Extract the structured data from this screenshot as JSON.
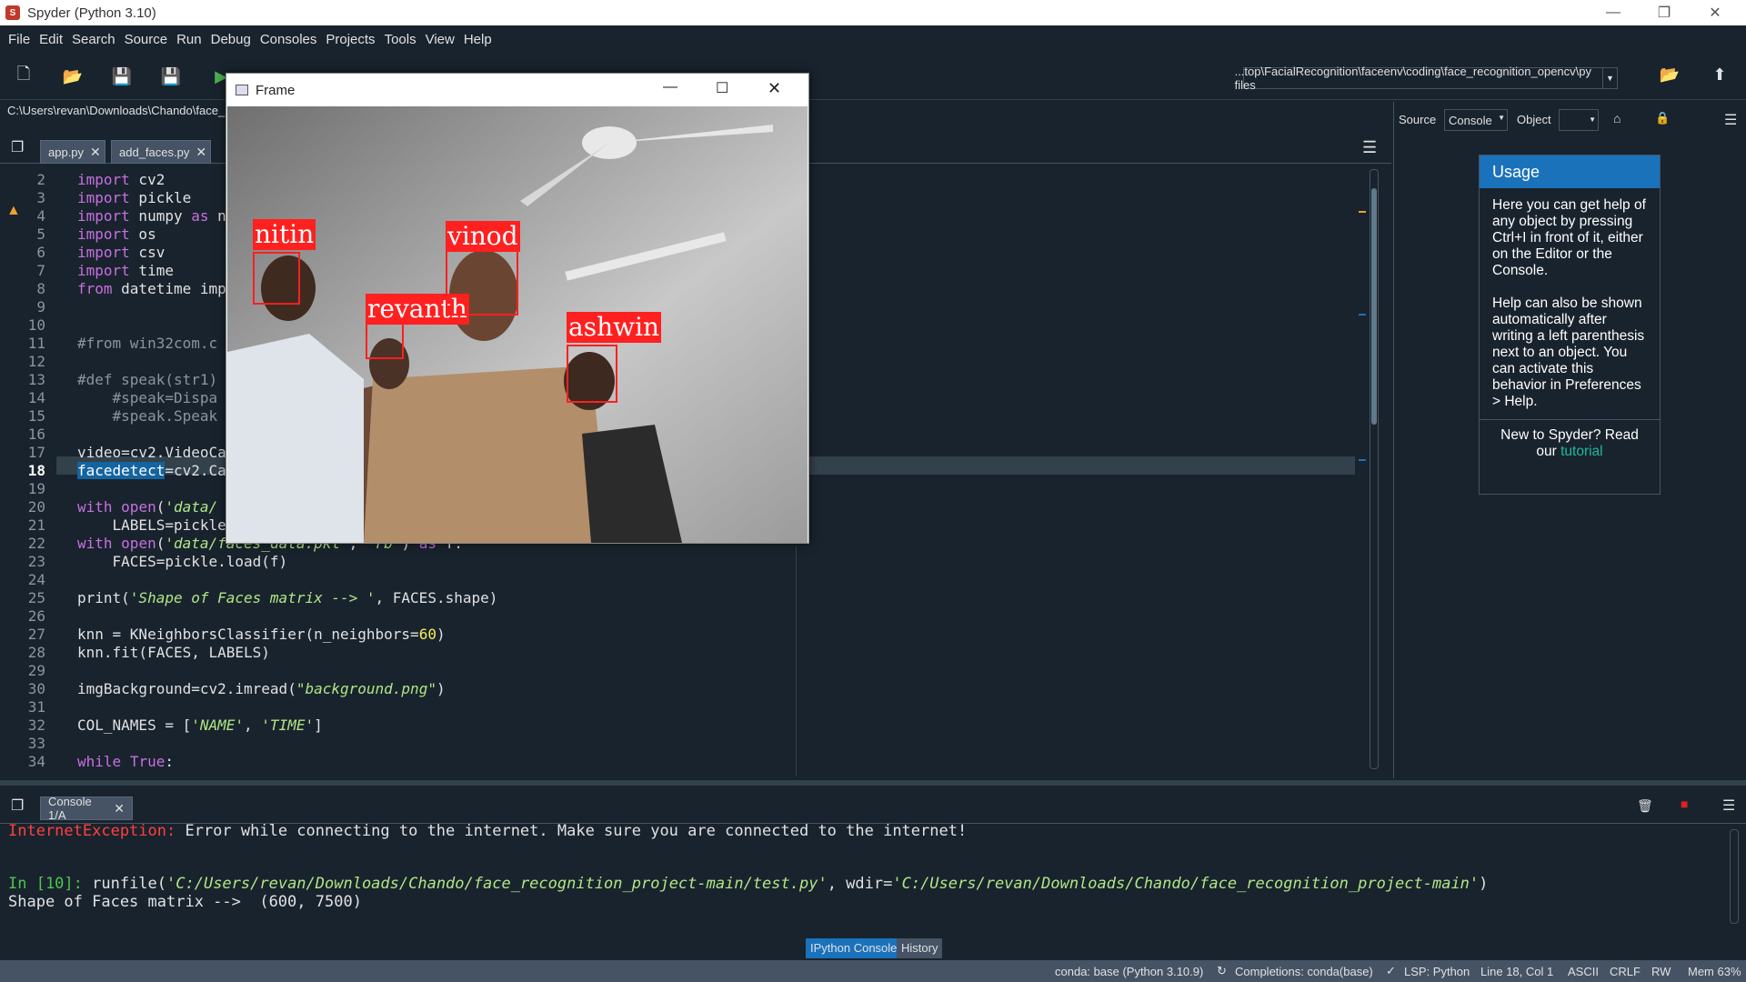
{
  "window": {
    "title": "Spyder (Python 3.10)",
    "min": "—",
    "max": "❐",
    "close": "✕"
  },
  "menu": [
    "File",
    "Edit",
    "Search",
    "Source",
    "Run",
    "Debug",
    "Consoles",
    "Projects",
    "Tools",
    "View",
    "Help"
  ],
  "toolbar": {
    "path": "...top\\FacialRecognition\\faceenv\\coding\\face_recognition_opencv\\py files"
  },
  "editor": {
    "path": "C:\\Users\\revan\\Downloads\\Chando\\face_",
    "tabs": [
      "app.py",
      "add_faces.py"
    ],
    "current_line": "18"
  },
  "code_lines": [
    {
      "n": "2",
      "t": "import cv2"
    },
    {
      "n": "3",
      "t": "import pickle"
    },
    {
      "n": "4",
      "t": "import numpy as n"
    },
    {
      "n": "5",
      "t": "import os"
    },
    {
      "n": "6",
      "t": "import csv"
    },
    {
      "n": "7",
      "t": "import time"
    },
    {
      "n": "8",
      "t": "from datetime imp"
    },
    {
      "n": "9",
      "t": ""
    },
    {
      "n": "10",
      "t": ""
    },
    {
      "n": "11",
      "t": "#from win32com.c"
    },
    {
      "n": "12",
      "t": ""
    },
    {
      "n": "13",
      "t": "#def speak(str1)"
    },
    {
      "n": "14",
      "t": "    #speak=Dispa"
    },
    {
      "n": "15",
      "t": "    #speak.Speak"
    },
    {
      "n": "16",
      "t": ""
    },
    {
      "n": "17",
      "t": "video=cv2.VideoCa"
    },
    {
      "n": "18",
      "t": "facedetect=cv2.Ca"
    },
    {
      "n": "19",
      "t": ""
    },
    {
      "n": "20",
      "t": "with open('data/"
    },
    {
      "n": "21",
      "t": "    LABELS=pickle"
    },
    {
      "n": "22",
      "t": "with open('data/faces_data.pkl', 'rb') as f:"
    },
    {
      "n": "23",
      "t": "    FACES=pickle.load(f)"
    },
    {
      "n": "24",
      "t": ""
    },
    {
      "n": "25",
      "t": "print('Shape of Faces matrix --> ', FACES.shape)"
    },
    {
      "n": "26",
      "t": ""
    },
    {
      "n": "27",
      "t": "knn = KNeighborsClassifier(n_neighbors=60)"
    },
    {
      "n": "28",
      "t": "knn.fit(FACES, LABELS)"
    },
    {
      "n": "29",
      "t": ""
    },
    {
      "n": "30",
      "t": "imgBackground=cv2.imread(\"background.png\")"
    },
    {
      "n": "31",
      "t": ""
    },
    {
      "n": "32",
      "t": "COL_NAMES = ['NAME', 'TIME']"
    },
    {
      "n": "33",
      "t": ""
    },
    {
      "n": "34",
      "t": "while True:"
    }
  ],
  "help": {
    "source_label": "Source",
    "source_value": "Console",
    "object_label": "Object",
    "usage_title": "Usage",
    "usage_p1": "Here you can get help of any object by pressing Ctrl+I in front of it, either on the Editor or the Console.",
    "usage_p2": "Help can also be shown automatically after writing a left parenthesis next to an object. You can activate this behavior in Preferences > Help.",
    "usage_p3a": "New to Spyder? Read our",
    "usage_p3b": "tutorial"
  },
  "frame": {
    "title": "Frame",
    "faces": [
      "nitin",
      "revanth",
      "vinod",
      "ashwin"
    ]
  },
  "console": {
    "tab": "Console 1/A",
    "line1_err": "InternetException:",
    "line1_rest": " Error while connecting to the internet. Make sure you are connected to the internet!",
    "prompt": "In [10]:",
    "cmd_a": " runfile(",
    "cmd_path": "'C:/Users/revan/Downloads/Chando/face_recognition_project-main/test.py'",
    "cmd_b": ", wdir=",
    "cmd_wdir": "'C:/Users/revan/Downloads/Chando/face_recognition_project-main'",
    "cmd_c": ")",
    "output": "Shape of Faces matrix -->  (600, 7500)"
  },
  "bottom_tabs": [
    "IPython Console",
    "History"
  ],
  "status": {
    "env": "conda: base (Python 3.10.9)",
    "completions": "Completions: conda(base)",
    "lsp": "LSP: Python",
    "pos": "Line 18, Col 1",
    "enc": "ASCII",
    "eol": "CRLF",
    "rw": "RW",
    "mem": "Mem 63%"
  },
  "colors": {
    "bg": "#19232d",
    "accent": "#1a72bb",
    "face_box": "#ff2020"
  }
}
